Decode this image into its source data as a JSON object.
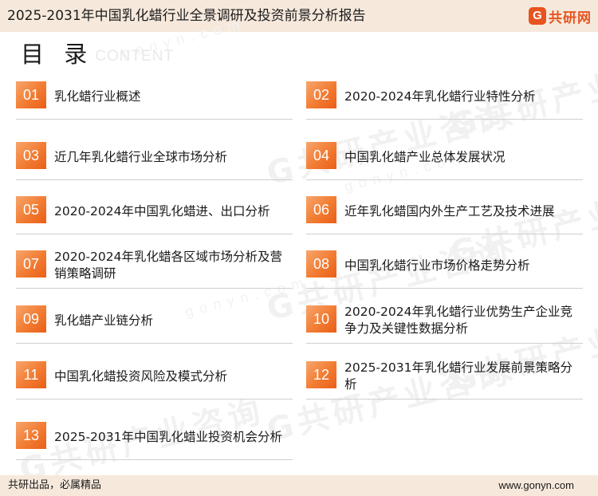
{
  "header": {
    "title": "2025-2031年中国乳化蜡行业全景调研及投资前景分析报告",
    "logo_mark": "G",
    "logo_text": "共研网",
    "accent_color": "#e8531f",
    "background_color": "#f6e9dc"
  },
  "toc": {
    "title": "目 录",
    "subtitle": "CONTENT",
    "items": [
      {
        "num": "01",
        "label": "乳化蜡行业概述"
      },
      {
        "num": "02",
        "label": "2020-2024年乳化蜡行业特性分析"
      },
      {
        "num": "03",
        "label": "近几年乳化蜡行业全球市场分析"
      },
      {
        "num": "04",
        "label": "中国乳化蜡产业总体发展状况"
      },
      {
        "num": "05",
        "label": "2020-2024年中国乳化蜡进、出口分析"
      },
      {
        "num": "06",
        "label": "近年乳化蜡国内外生产工艺及技术进展"
      },
      {
        "num": "07",
        "label": "2020-2024年乳化蜡各区域市场分析及营销策略调研"
      },
      {
        "num": "08",
        "label": "中国乳化蜡行业市场价格走势分析"
      },
      {
        "num": "09",
        "label": "乳化蜡产业链分析"
      },
      {
        "num": "10",
        "label": "2020-2024年乳化蜡行业优势生产企业竞争力及关键性数据分析"
      },
      {
        "num": "11",
        "label": "中国乳化蜡投资风险及模式分析"
      },
      {
        "num": "12",
        "label": "2025-2031年乳化蜡行业发展前景策略分析"
      },
      {
        "num": "13",
        "label": "2025-2031年中国乳化蜡业投资机会分析"
      }
    ],
    "number_box_color": "#f27b32"
  },
  "watermark": {
    "text": "G共研产业咨询",
    "url_text": "gonyn.com"
  },
  "footer": {
    "left_text": "共研出品，必属精品",
    "right_text": "www.gonyn.com"
  }
}
